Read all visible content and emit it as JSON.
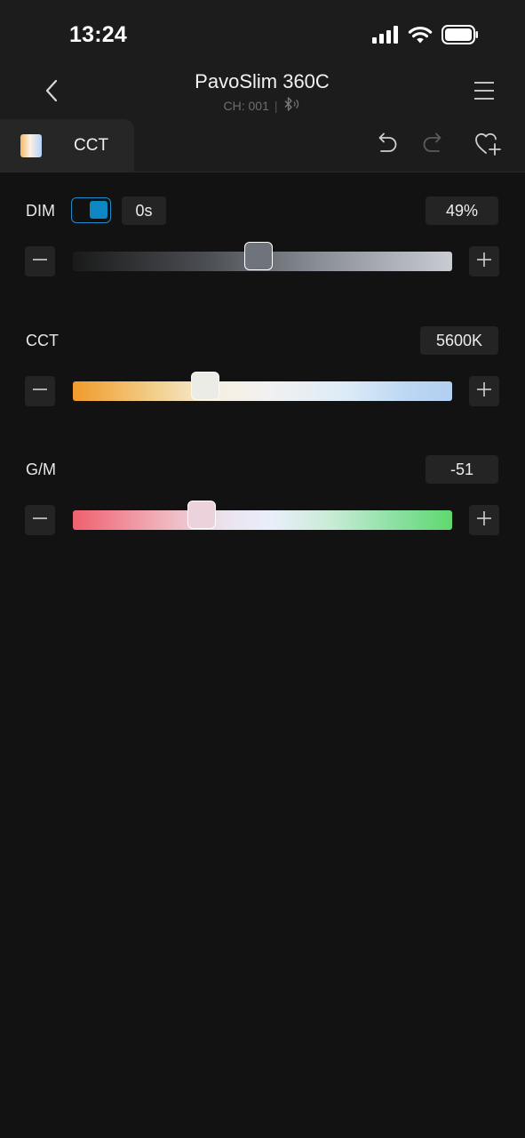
{
  "status_bar": {
    "time": "13:24"
  },
  "header": {
    "title": "PavoSlim 360C",
    "channel": "CH: 001",
    "separator": "|"
  },
  "mode_tab": {
    "label": "CCT"
  },
  "controls": {
    "dim": {
      "label": "DIM",
      "fade_enabled": true,
      "fade_time": "0s",
      "value_text": "49%",
      "level": 49,
      "min": 0,
      "max": 100
    },
    "cct": {
      "label": "CCT",
      "value_text": "5600K",
      "level_fraction": 0.35
    },
    "gm": {
      "label": "G/M",
      "value_text": "-51",
      "level_fraction": 0.34
    }
  },
  "icons": {
    "back": "chevron-left-icon",
    "menu": "hamburger-menu-icon",
    "bluetooth": "bluetooth-icon",
    "undo": "undo-icon",
    "redo": "redo-icon",
    "favorite_add": "heart-plus-icon",
    "minus": "minus-icon",
    "plus": "plus-icon"
  },
  "colors": {
    "background": "#121212",
    "header_background": "#1c1c1c",
    "accent": "#0c87c4"
  }
}
